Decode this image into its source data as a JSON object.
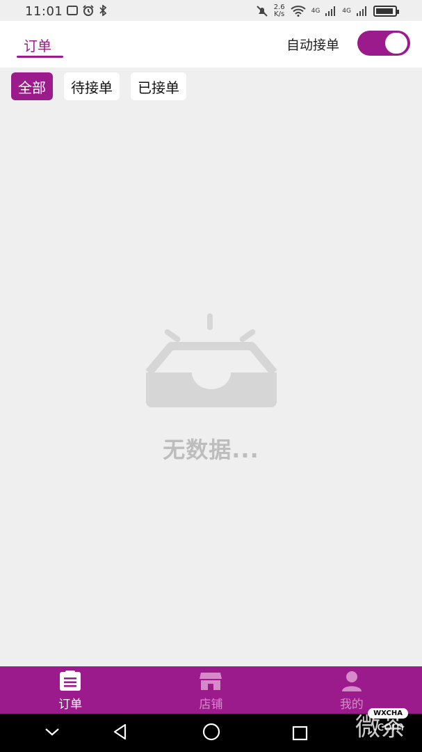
{
  "status_bar": {
    "time": "11:01",
    "net_speed_value": "2.6",
    "net_speed_unit": "K/s",
    "signal_1": "4G",
    "signal_2": "4G"
  },
  "header": {
    "tab_label": "订单",
    "auto_accept_label": "自动接单",
    "auto_accept_on": true
  },
  "filters": [
    "全部",
    "待接单",
    "已接单"
  ],
  "empty_state": {
    "text": "无数据..."
  },
  "bottom_nav": {
    "items": [
      {
        "label": "订单",
        "icon": "order-list-icon",
        "active": true
      },
      {
        "label": "店铺",
        "icon": "store-icon",
        "active": false
      },
      {
        "label": "我的",
        "icon": "user-icon",
        "active": false
      }
    ]
  },
  "watermark": {
    "text": "微茶",
    "badge": "WXCHA",
    "domain": ".com"
  },
  "colors": {
    "accent": "#9c1b8c",
    "background": "#efefef"
  }
}
